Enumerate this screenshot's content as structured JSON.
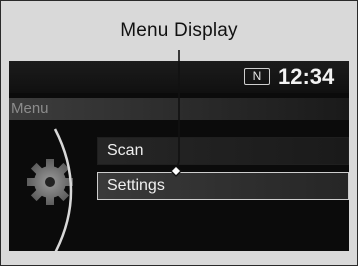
{
  "callout": {
    "label": "Menu Display"
  },
  "status_bar": {
    "gear_indicator": "N",
    "time": "12:34"
  },
  "header": {
    "title": "Menu"
  },
  "menu": {
    "items": [
      {
        "label": "Scan",
        "selected": false
      },
      {
        "label": "Settings",
        "selected": true
      }
    ]
  },
  "icons": {
    "menu_category": "gear-icon"
  },
  "colors": {
    "screen_background": "#0b0b0b",
    "text": "#efefef",
    "selection_border": "#cdcdcd",
    "frame_background": "#d9d9d9"
  }
}
